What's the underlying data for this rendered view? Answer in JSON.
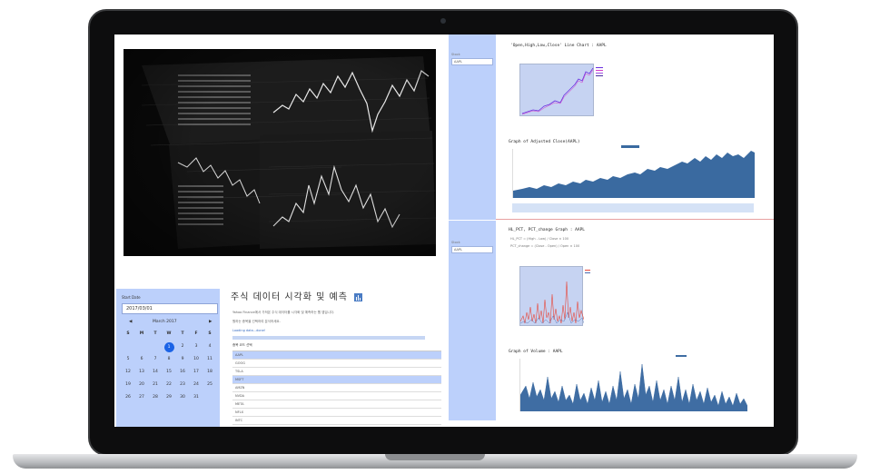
{
  "colors": {
    "accent": "#bcd0fb",
    "selected_day": "#1b63e6",
    "area_fill": "#3a6aa0",
    "volume_fill": "#3f6da3",
    "price_line": "#6a2ee0",
    "change_red": "#e8473a"
  },
  "left": {
    "date_label": "Start Date",
    "date_value": "2017/03/01",
    "calendar": {
      "prev_icon": "prev-month-arrow",
      "month": "March 2017",
      "next_icon": "next-month-arrow",
      "dow": [
        "S",
        "M",
        "T",
        "W",
        "T",
        "F",
        "S"
      ],
      "weeks": [
        [
          "",
          "",
          "",
          "1",
          "2",
          "3",
          "4"
        ],
        [
          "5",
          "6",
          "7",
          "8",
          "9",
          "10",
          "11"
        ],
        [
          "12",
          "13",
          "14",
          "15",
          "16",
          "17",
          "18"
        ],
        [
          "19",
          "20",
          "21",
          "22",
          "23",
          "24",
          "25"
        ],
        [
          "26",
          "27",
          "28",
          "29",
          "30",
          "31",
          ""
        ]
      ],
      "selected": "1"
    },
    "title": "주식 데이터 시각화 및 예측",
    "title_icon": "chart-icon",
    "desc": "Yahoo Finance에서 가져온 주식 데이터를 시각화 및 예측하는 웹 앱입니다.",
    "subdesc": "원하는 종목을 선택하여 분석하세요.",
    "link_label": "Loading data...done!",
    "list_label": "종목 코드 선택",
    "options": [
      "AAPL",
      "GOOG",
      "TSLA",
      "MSFT",
      "AMZN",
      "NVDA",
      "META",
      "NFLX",
      "INTC"
    ],
    "selected_options": [
      "AAPL",
      "MSFT"
    ]
  },
  "right_top": {
    "side_label": "Stock",
    "side_input": "AAPL",
    "title1": "'Open,High,Low,Close' Line Chart : AAPL",
    "title2": "Graph of Adjusted Close(AAPL)"
  },
  "right_bottom": {
    "side_label": "Stock",
    "side_input": "AAPL",
    "title1": "HL_PCT, PCT_change Graph : AAPL",
    "bullet1": "HL_PCT = (High - Low) / Close × 100",
    "bullet2": "PCT_change = (Close - Open) / Open × 100",
    "title2": "Graph of Volume : AAPL"
  }
}
